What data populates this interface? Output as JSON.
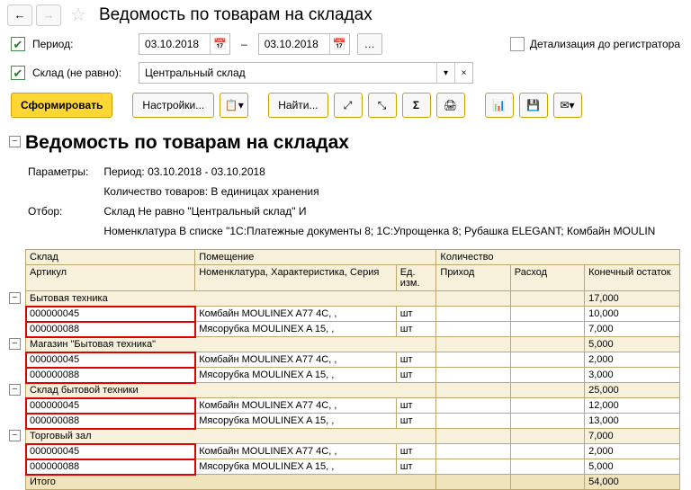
{
  "header": {
    "title": "Ведомость по товарам на складах"
  },
  "filters": {
    "period_label": "Период:",
    "date_from": "03.10.2018",
    "date_to": "03.10.2018",
    "warehouse_label": "Склад (не равно):",
    "warehouse_value": "Центральный склад",
    "detail_label": "Детализация до регистратора"
  },
  "toolbar": {
    "generate": "Сформировать",
    "settings": "Настройки...",
    "find": "Найти..."
  },
  "report": {
    "title": "Ведомость по товарам на складах",
    "params_label": "Параметры:",
    "filter_label": "Отбор:",
    "param_period": "Период: 03.10.2018 - 03.10.2018",
    "param_qty": "Количество товаров: В единицах хранения",
    "filter_warehouse": "Склад Не равно \"Центральный склад\" И",
    "filter_nomenclature": "Номенклатура В списке \"1С:Платежные документы 8; 1С:Упрощенка 8; Рубашка ELEGANT; Комбайн MOULIN",
    "headers": {
      "warehouse": "Склад",
      "room": "Помещение",
      "qty": "Количество",
      "article": "Артикул",
      "nomenclature": "Номенклатура, Характеристика, Серия",
      "unit": "Ед. изм.",
      "income": "Приход",
      "expense": "Расход",
      "balance": "Конечный остаток"
    },
    "groups": [
      {
        "name": "Бытовая техника",
        "balance": "17,000",
        "rows": [
          {
            "art": "000000045",
            "nom": "Комбайн MOULINEX  A77 4C, ,",
            "unit": "шт",
            "bal": "10,000"
          },
          {
            "art": "000000088",
            "nom": "Мясорубка MOULINEX  A 15, ,",
            "unit": "шт",
            "bal": "7,000"
          }
        ]
      },
      {
        "name": "Магазин \"Бытовая техника\"",
        "balance": "5,000",
        "rows": [
          {
            "art": "000000045",
            "nom": "Комбайн MOULINEX  A77 4C, ,",
            "unit": "шт",
            "bal": "2,000"
          },
          {
            "art": "000000088",
            "nom": "Мясорубка MOULINEX  A 15, ,",
            "unit": "шт",
            "bal": "3,000"
          }
        ]
      },
      {
        "name": "Склад бытовой техники",
        "balance": "25,000",
        "rows": [
          {
            "art": "000000045",
            "nom": "Комбайн MOULINEX  A77 4C, ,",
            "unit": "шт",
            "bal": "12,000"
          },
          {
            "art": "000000088",
            "nom": "Мясорубка MOULINEX  A 15, ,",
            "unit": "шт",
            "bal": "13,000"
          }
        ]
      },
      {
        "name": "Торговый зал",
        "balance": "7,000",
        "rows": [
          {
            "art": "000000045",
            "nom": "Комбайн MOULINEX  A77 4C, ,",
            "unit": "шт",
            "bal": "2,000"
          },
          {
            "art": "000000088",
            "nom": "Мясорубка MOULINEX  A 15, ,",
            "unit": "шт",
            "bal": "5,000"
          }
        ]
      }
    ],
    "total_label": "Итого",
    "total_balance": "54,000"
  }
}
